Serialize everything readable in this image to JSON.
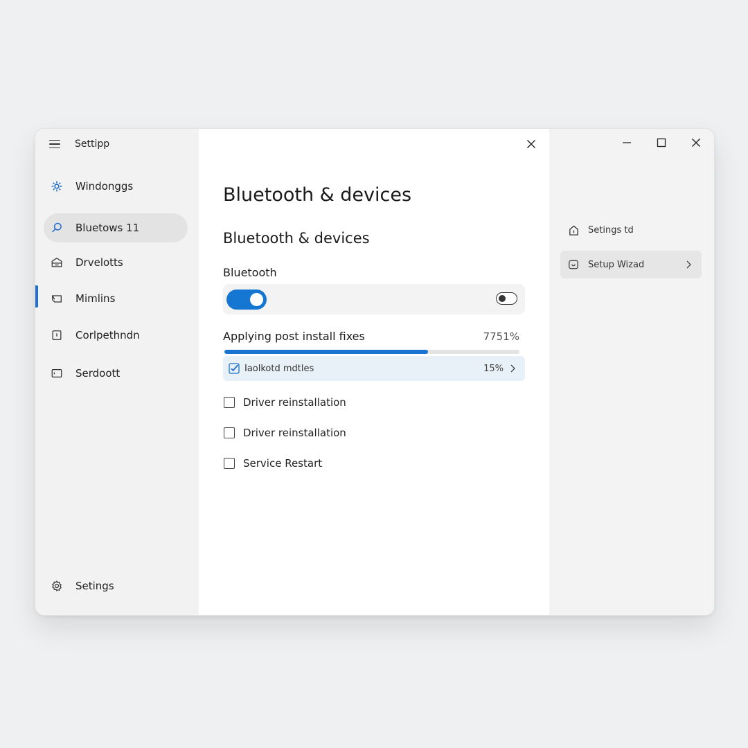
{
  "app": {
    "title": "Settipp"
  },
  "sidebar": {
    "items": [
      {
        "label": "Windonggs",
        "icon": "windows-gear-icon"
      },
      {
        "label": "Bluetows 11",
        "icon": "search-icon"
      },
      {
        "label": "Drvelotts",
        "icon": "devices-icon"
      },
      {
        "label": "Mimlins",
        "icon": "mail-icon"
      },
      {
        "label": "Corlpethndn",
        "icon": "tablet-icon"
      },
      {
        "label": "Serdoott",
        "icon": "display-icon"
      }
    ],
    "footer_label": "Setings",
    "footer_icon": "settings-gear-icon"
  },
  "content": {
    "page_title": "Bluetooth & devices",
    "section_title": "Bluetooth & devices",
    "bluetooth_label": "Bluetooth",
    "bluetooth_on": true,
    "secondary_toggle_on": false,
    "progress": {
      "label": "Applying post install fixes",
      "percent_text": "7751%",
      "fill_fraction": 0.69
    },
    "active_step": {
      "label": "Iaolkotd mdtles",
      "percent": "15%",
      "checked": true
    },
    "steps": [
      {
        "label": "Driver reinstallation",
        "checked": false
      },
      {
        "label": "Driver reinstallation",
        "checked": false
      },
      {
        "label": "Service Restart",
        "checked": false
      }
    ]
  },
  "right_pane": {
    "items": [
      {
        "label": "Setings td",
        "icon": "home-icon"
      },
      {
        "label": "Setup Wizad",
        "icon": "wizard-icon"
      }
    ]
  },
  "colors": {
    "accent": "#1677d2",
    "window_bg": "#f3f3f3",
    "content_bg": "#ffffff",
    "active_step_bg": "#e8f0f8"
  }
}
